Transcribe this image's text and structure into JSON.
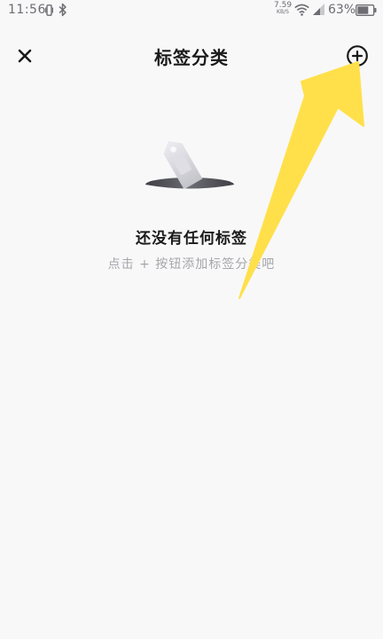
{
  "status_bar": {
    "time": "11:56",
    "net_speed_value": "7.59",
    "net_speed_unit": "KB/S",
    "battery_percent": "63%",
    "icons": [
      "vibrate-icon",
      "bluetooth-icon",
      "wifi-icon",
      "signal-icon",
      "battery-icon"
    ]
  },
  "header": {
    "title": "标签分类",
    "close_icon": "close-icon",
    "add_icon": "add-circle-icon"
  },
  "empty_state": {
    "illustration": "tag-in-hole-illustration",
    "title": "还没有任何标签",
    "hint": "点击 + 按钮添加标签分类吧"
  },
  "overlay": {
    "icon": "yellow-arrow-pointer",
    "color": "#ffe04a"
  }
}
